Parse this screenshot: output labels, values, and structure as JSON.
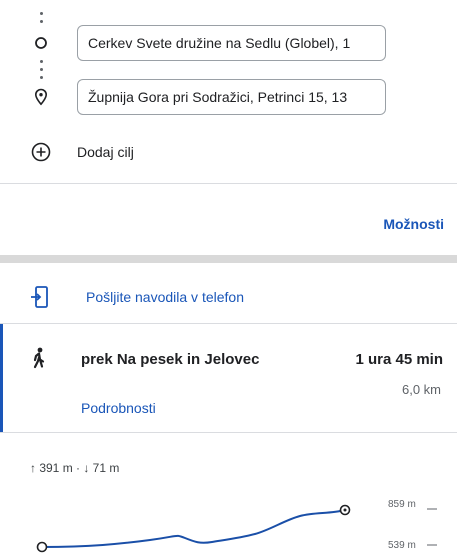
{
  "directions": {
    "origin_value": "Cerkev Svete družine na Sedlu (Globel), 1",
    "destination_value": "Župnija Gora pri Sodražici, Petrinci 15, 13",
    "add_destination_label": "Dodaj cilj"
  },
  "options_label": "Možnosti",
  "send_to_phone_label": "Pošljite navodila v telefon",
  "route": {
    "via": "prek Na pesek in Jelovec",
    "duration": "1 ura 45 min",
    "distance": "6,0 km",
    "details_label": "Podrobnosti"
  },
  "elevation": {
    "summary": "↑ 391 m · ↓ 71 m",
    "max_label": "859 m",
    "min_label": "539 m"
  },
  "colors": {
    "accent": "#1a56b8",
    "profile_line": "#1a4fa8",
    "section_divider": "#d9d9d9"
  }
}
